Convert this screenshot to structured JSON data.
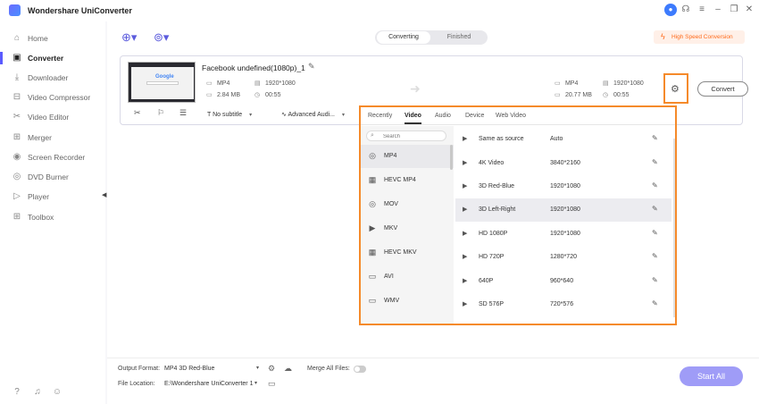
{
  "app": {
    "title": "Wondershare UniConverter"
  },
  "sidebar": {
    "items": [
      {
        "label": "Home",
        "icon": "home-icon"
      },
      {
        "label": "Converter",
        "icon": "converter-icon"
      },
      {
        "label": "Downloader",
        "icon": "download-icon"
      },
      {
        "label": "Video Compressor",
        "icon": "compress-icon"
      },
      {
        "label": "Video Editor",
        "icon": "scissors-icon"
      },
      {
        "label": "Merger",
        "icon": "merge-icon"
      },
      {
        "label": "Screen Recorder",
        "icon": "record-icon"
      },
      {
        "label": "DVD Burner",
        "icon": "disc-icon"
      },
      {
        "label": "Player",
        "icon": "play-icon"
      },
      {
        "label": "Toolbox",
        "icon": "grid-icon"
      }
    ],
    "active_index": 1
  },
  "header": {
    "tabs": [
      "Converting",
      "Finished"
    ],
    "active_tab": "Converting",
    "high_speed_label": "High Speed Conversion"
  },
  "file": {
    "name": "Facebook undefined(1080p)_1",
    "source": {
      "format": "MP4",
      "resolution": "1920*1080",
      "size": "2.84 MB",
      "duration": "00:55"
    },
    "target": {
      "format": "MP4",
      "resolution": "1920*1080",
      "size": "20.77 MB",
      "duration": "00:55"
    },
    "subtitle": "No subtitle",
    "audio": "Advanced Audi...",
    "convert_label": "Convert"
  },
  "format_panel": {
    "tabs": [
      "Recently",
      "Video",
      "Audio",
      "Device",
      "Web Video"
    ],
    "active_tab": "Video",
    "search_placeholder": "Search",
    "formats": [
      {
        "label": "MP4",
        "icon": "mp4-icon"
      },
      {
        "label": "HEVC MP4",
        "icon": "hevc-mp4-icon"
      },
      {
        "label": "MOV",
        "icon": "mov-icon"
      },
      {
        "label": "MKV",
        "icon": "mkv-icon"
      },
      {
        "label": "HEVC MKV",
        "icon": "hevc-mkv-icon"
      },
      {
        "label": "AVI",
        "icon": "avi-icon"
      },
      {
        "label": "WMV",
        "icon": "wmv-icon"
      }
    ],
    "selected_format": "MP4",
    "resolutions": [
      {
        "name": "Same as source",
        "value": "Auto"
      },
      {
        "name": "4K Video",
        "value": "3840*2160"
      },
      {
        "name": "3D Red-Blue",
        "value": "1920*1080"
      },
      {
        "name": "3D Left-Right",
        "value": "1920*1080"
      },
      {
        "name": "HD 1080P",
        "value": "1920*1080"
      },
      {
        "name": "HD 720P",
        "value": "1280*720"
      },
      {
        "name": "640P",
        "value": "960*640"
      },
      {
        "name": "SD 576P",
        "value": "720*576"
      }
    ],
    "selected_resolution": "3D Left-Right"
  },
  "bottom": {
    "output_format_label": "Output Format:",
    "output_format_value": "MP4 3D Red-Blue",
    "merge_label": "Merge All Files:",
    "file_location_label": "File Location:",
    "file_location_value": "E:\\Wondershare UniConverter 1",
    "start_all_label": "Start All"
  },
  "colors": {
    "accent": "#5b5bff",
    "highlight": "#f58a2a",
    "start_all": "#9f9cf7"
  }
}
